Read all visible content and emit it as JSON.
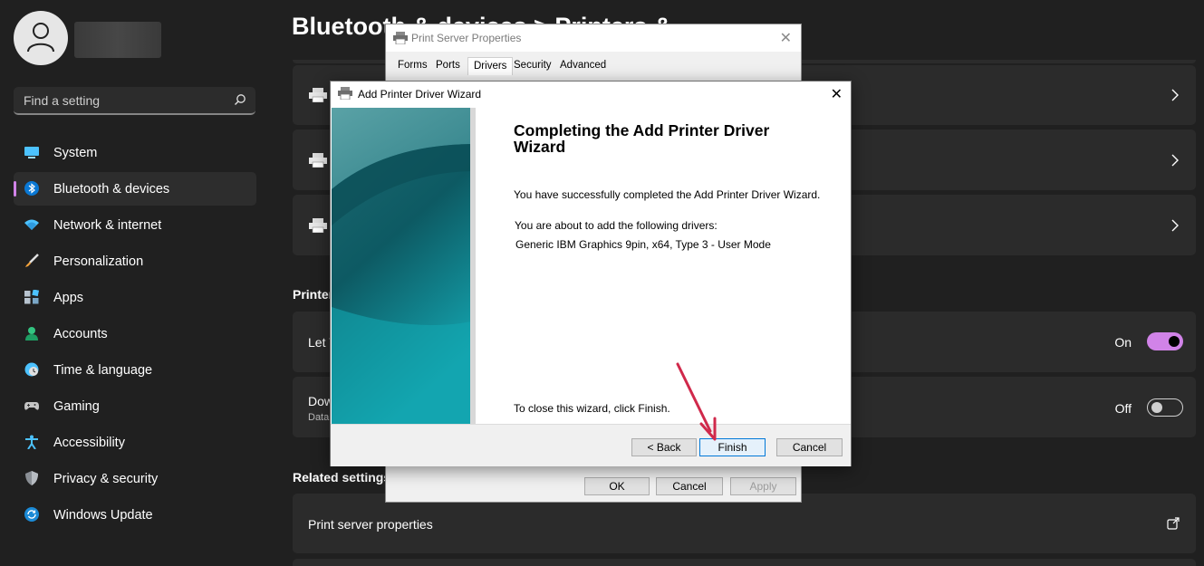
{
  "sidebar": {
    "search_placeholder": "Find a setting",
    "items": [
      {
        "label": "System",
        "icon": "monitor-icon"
      },
      {
        "label": "Bluetooth & devices",
        "icon": "bluetooth-icon",
        "active": true
      },
      {
        "label": "Network & internet",
        "icon": "wifi-icon"
      },
      {
        "label": "Personalization",
        "icon": "brush-icon"
      },
      {
        "label": "Apps",
        "icon": "apps-icon"
      },
      {
        "label": "Accounts",
        "icon": "person-icon"
      },
      {
        "label": "Time & language",
        "icon": "clock-globe-icon"
      },
      {
        "label": "Gaming",
        "icon": "gamepad-icon"
      },
      {
        "label": "Accessibility",
        "icon": "accessibility-icon"
      },
      {
        "label": "Privacy & security",
        "icon": "shield-icon"
      },
      {
        "label": "Windows Update",
        "icon": "sync-icon"
      }
    ]
  },
  "main": {
    "title": "Bluetooth & devices  >  Printers &",
    "printer_prefs_header": "Printer",
    "row_let_label": "Let V",
    "row_let_state": "On",
    "row_download_label": "Dow",
    "row_download_sub": "Data",
    "row_download_state": "Off",
    "related_settings_header": "Related settings",
    "print_server_link": "Print server properties"
  },
  "print_server_dialog": {
    "title": "Print Server Properties",
    "tabs": [
      "Forms",
      "Ports",
      "Drivers",
      "Security",
      "Advanced"
    ],
    "selected_tab": "Drivers",
    "ok": "OK",
    "cancel": "Cancel",
    "apply": "Apply"
  },
  "wizard": {
    "title": "Add Printer Driver Wizard",
    "heading": "Completing the Add Printer Driver Wizard",
    "success": "You have successfully completed the Add Printer Driver Wizard.",
    "about": "You are about to add the following drivers:",
    "driver": "Generic IBM Graphics 9pin, x64, Type 3 - User Mode",
    "close_hint": "To close this wizard, click Finish.",
    "back": "< Back",
    "finish": "Finish",
    "cancel": "Cancel"
  },
  "colors": {
    "accent": "#d183e8",
    "annotation_arrow": "#d0294b",
    "banner_teal": "#1a8a94"
  }
}
